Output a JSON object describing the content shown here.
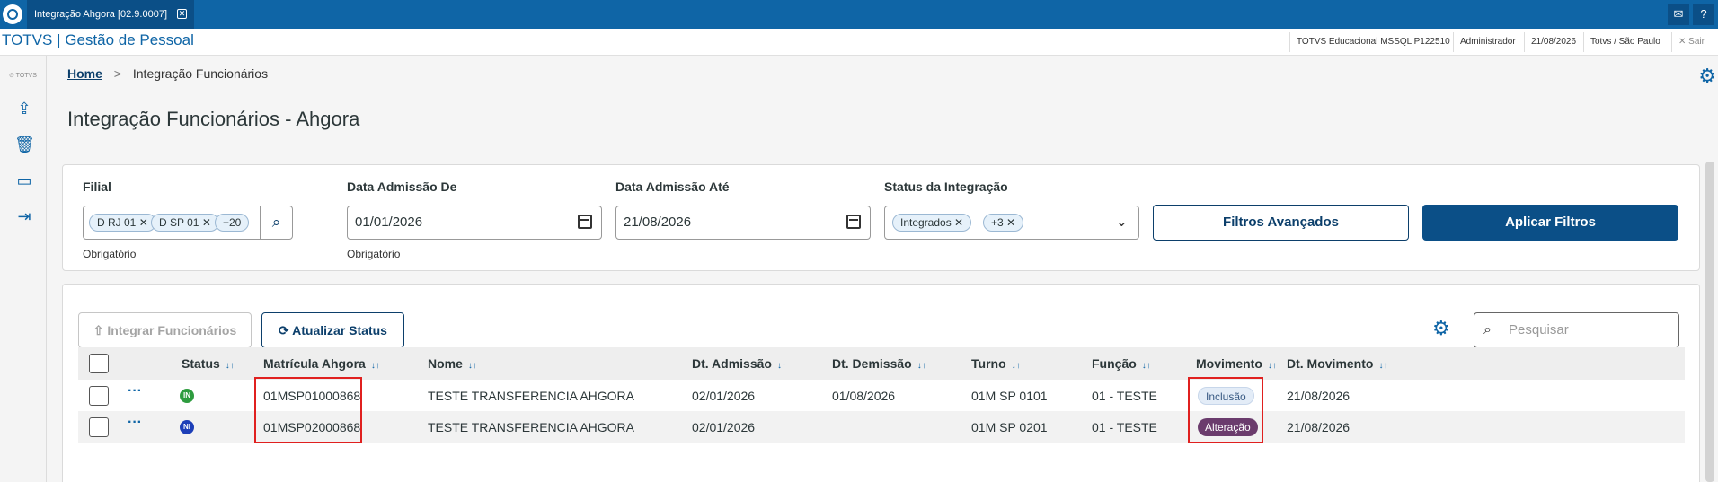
{
  "window": {
    "tab_title": "Integração Ahgora [02.9.0007]",
    "close_glyph": "✕"
  },
  "topbar_icons": {
    "mail": "✉",
    "help": "?"
  },
  "header": {
    "brand": "TOTVS | Gestão de Pessoal",
    "environment": "TOTVS Educacional MSSQL P122510",
    "user": "Administrador",
    "date": "21/08/2026",
    "timezone": "Totvs / São Paulo",
    "exit_label": "Sair"
  },
  "sidebar": {
    "brand_mini": "⊙ TOTVS"
  },
  "breadcrumb": {
    "home": "Home",
    "separator": ">",
    "current": "Integração Funcionários"
  },
  "page": {
    "title": "Integração Funcionários - Ahgora"
  },
  "filters": {
    "filial": {
      "label": "Filial",
      "tags": [
        "D RJ 01",
        "D SP 01",
        "+20"
      ],
      "help": "Obrigatório"
    },
    "data_de": {
      "label": "Data Admissão De",
      "value": "01/01/2026",
      "help": "Obrigatório"
    },
    "data_ate": {
      "label": "Data Admissão Até",
      "value": "21/08/2026"
    },
    "status": {
      "label": "Status da Integração",
      "tags": [
        "Integrados",
        "+3"
      ]
    },
    "advanced_label": "Filtros Avançados",
    "apply_label": "Aplicar Filtros"
  },
  "table_actions": {
    "integrar_label": "Integrar Funcionários",
    "atualizar_label": "Atualizar Status",
    "search_placeholder": "Pesquisar"
  },
  "table": {
    "columns": [
      "Status",
      "Matrícula Ahgora",
      "Nome",
      "Dt. Admissão",
      "Dt. Demissão",
      "Turno",
      "Função",
      "Movimento",
      "Dt. Movimento"
    ],
    "rows": [
      {
        "status": "IN",
        "matricula": "01MSP01000868",
        "nome": "TESTE TRANSFERENCIA AHGORA",
        "admissao": "02/01/2026",
        "demissao": "01/08/2026",
        "turno": "01M SP 0101",
        "funcao": "01 - TESTE",
        "movimento": "Inclusão",
        "dt_movimento": "21/08/2026"
      },
      {
        "status": "NI",
        "matricula": "01MSP02000868",
        "nome": "TESTE TRANSFERENCIA AHGORA",
        "admissao": "02/01/2026",
        "demissao": "",
        "turno": "01M SP 0201",
        "funcao": "01 - TESTE",
        "movimento": "Alteração",
        "dt_movimento": "21/08/2026"
      }
    ]
  },
  "colors": {
    "primary": "#0b4f87",
    "status_in": "#2e9c3f",
    "status_ni": "#1d3fb8",
    "badge_inclusao_bg": "#e3ecf7",
    "badge_alteracao_bg": "#6b3c6d",
    "highlight": "#e0201f"
  }
}
